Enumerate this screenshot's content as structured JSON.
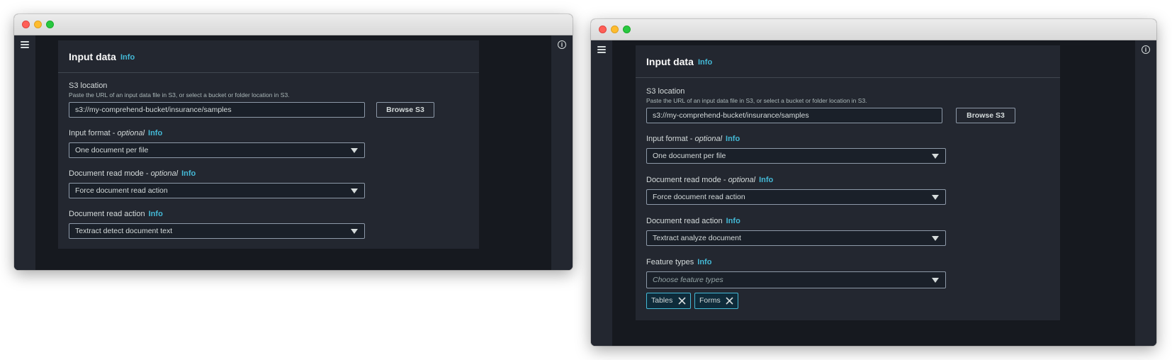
{
  "left_window": {
    "nav": {
      "menu_icon": "hamburger-menu-icon",
      "info_icon": "info-circle-icon"
    },
    "panel": {
      "title": "Input data",
      "title_info": "Info",
      "s3_location": {
        "label": "S3 location",
        "description": "Paste the URL of an input data file in S3, or select a bucket or folder location in S3.",
        "value": "s3://my-comprehend-bucket/insurance/samples",
        "browse_label": "Browse S3"
      },
      "input_format": {
        "label": "Input format - ",
        "optional": "optional",
        "info": "Info",
        "value": "One document per file"
      },
      "read_mode": {
        "label": "Document read mode - ",
        "optional": "optional",
        "info": "Info",
        "value": "Force document read action"
      },
      "read_action": {
        "label": "Document read action",
        "info": "Info",
        "value": "Textract detect document text"
      }
    }
  },
  "right_window": {
    "nav": {
      "menu_icon": "hamburger-menu-icon",
      "info_icon": "info-circle-icon"
    },
    "panel": {
      "title": "Input data",
      "title_info": "Info",
      "s3_location": {
        "label": "S3 location",
        "description": "Paste the URL of an input data file in S3, or select a bucket or folder location in S3.",
        "value": "s3://my-comprehend-bucket/insurance/samples",
        "browse_label": "Browse S3"
      },
      "input_format": {
        "label": "Input format - ",
        "optional": "optional",
        "info": "Info",
        "value": "One document per file"
      },
      "read_mode": {
        "label": "Document read mode - ",
        "optional": "optional",
        "info": "Info",
        "value": "Force document read action"
      },
      "read_action": {
        "label": "Document read action",
        "info": "Info",
        "value": "Textract analyze document"
      },
      "feature_types": {
        "label": "Feature types",
        "info": "Info",
        "placeholder": "Choose feature types",
        "tokens": [
          "Tables",
          "Forms"
        ]
      }
    }
  },
  "colors": {
    "accent_link": "#44b9d6",
    "background": "#16191f",
    "panel": "#232730",
    "token_bg": "#0e2b3a"
  }
}
